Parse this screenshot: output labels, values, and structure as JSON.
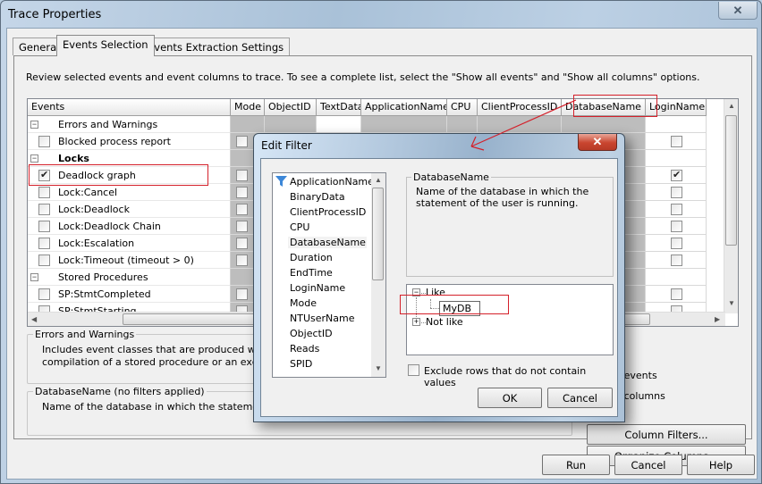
{
  "window": {
    "title": "Trace Properties",
    "close_icon": "close-icon"
  },
  "tabs": [
    {
      "label": "General",
      "active": false
    },
    {
      "label": "Events Selection",
      "active": true
    },
    {
      "label": "Events Extraction Settings",
      "active": false
    }
  ],
  "intro_text": "Review selected events and event columns to trace. To see a complete list, select the \"Show all events\" and \"Show all columns\" options.",
  "grid": {
    "columns": [
      "Events",
      "Mode",
      "ObjectID",
      "TextData",
      "ApplicationName",
      "CPU",
      "ClientProcessID",
      "DatabaseName",
      "LoginName"
    ],
    "rows": [
      {
        "type": "category",
        "label": "Errors and Warnings",
        "expander": "−",
        "bold": false
      },
      {
        "type": "event",
        "label": "Blocked process report",
        "checked": false
      },
      {
        "type": "category",
        "label": "Locks",
        "expander": "−",
        "bold": true
      },
      {
        "type": "event",
        "label": "Deadlock graph",
        "checked": true
      },
      {
        "type": "event",
        "label": "Lock:Cancel",
        "checked": false
      },
      {
        "type": "event",
        "label": "Lock:Deadlock",
        "checked": false
      },
      {
        "type": "event",
        "label": "Lock:Deadlock Chain",
        "checked": false
      },
      {
        "type": "event",
        "label": "Lock:Escalation",
        "checked": false
      },
      {
        "type": "event",
        "label": "Lock:Timeout (timeout > 0)",
        "checked": false
      },
      {
        "type": "category",
        "label": "Stored Procedures",
        "expander": "−",
        "bold": false
      },
      {
        "type": "event",
        "label": "SP:StmtCompleted",
        "checked": false
      },
      {
        "type": "event",
        "label": "SP:StmtStarting",
        "checked": false
      }
    ]
  },
  "event_description": {
    "title": "Errors and Warnings",
    "lines": [
      "Includes event classes that are produced when a",
      "compilation of a stored procedure or an exception i"
    ]
  },
  "column_description": {
    "title": "DatabaseName (no filters applied)",
    "lines": [
      "Name of the database in which the statement of th"
    ]
  },
  "options": {
    "show_all_events": "ll events",
    "show_all_events_underline": "e",
    "show_all_columns": "ll columns",
    "show_all_columns_underline": "c"
  },
  "buttons": {
    "column_filters": "Column Filters...",
    "organize_columns": "Organize Columns...",
    "run": "Run",
    "cancel": "Cancel",
    "help": "Help"
  },
  "edit_filter": {
    "title": "Edit Filter",
    "columns": [
      "ApplicationName",
      "BinaryData",
      "ClientProcessID",
      "CPU",
      "DatabaseName",
      "Duration",
      "EndTime",
      "LoginName",
      "Mode",
      "NTUserName",
      "ObjectID",
      "Reads",
      "SPID"
    ],
    "selected_column": "DatabaseName",
    "filtered_column": "ApplicationName",
    "description_title": "DatabaseName",
    "description_lines": [
      "Name of the database in which the",
      "statement of the user is running."
    ],
    "tree": {
      "like_label": "Like",
      "like_value": "MyDB",
      "not_like_label": "Not like"
    },
    "exclude_label": "Exclude rows that do not contain values",
    "exclude_checked": false,
    "ok": "OK",
    "cancel": "Cancel"
  },
  "annotation_color": "#d4202a"
}
